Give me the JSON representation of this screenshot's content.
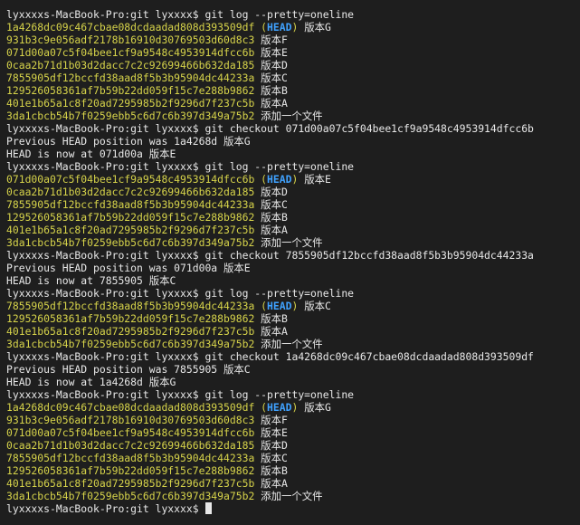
{
  "terminal": {
    "lines": [
      {
        "type": "cmd",
        "text": "lyxxxxs-MacBook-Pro:git lyxxxx$ git log --pretty=oneline"
      },
      {
        "type": "log",
        "hash": "1a4268dc09c467cbae08dcdaadad808d393509df",
        "head": "HEAD",
        "msg": "版本G"
      },
      {
        "type": "log",
        "hash": "931b3c9e056adf2178b16910d30769503d60d8c3",
        "msg": "版本F"
      },
      {
        "type": "log",
        "hash": "071d00a07c5f04bee1cf9a9548c4953914dfcc6b",
        "msg": "版本E"
      },
      {
        "type": "log",
        "hash": "0caa2b71d1b03d2dacc7c2c92699466b632da185",
        "msg": "版本D"
      },
      {
        "type": "log",
        "hash": "7855905df12bccfd38aad8f5b3b95904dc44233a",
        "msg": "版本C"
      },
      {
        "type": "log",
        "hash": "129526058361af7b59b22dd059f15c7e288b9862",
        "msg": "版本B"
      },
      {
        "type": "log",
        "hash": "401e1b65a1c8f20ad7295985b2f9296d7f237c5b",
        "msg": "版本A"
      },
      {
        "type": "log",
        "hash": "3da1cbcb54b7f0259ebb5c6d7c6b397d349a75b2",
        "msg": "添加一个文件"
      },
      {
        "type": "cmd",
        "text": "lyxxxxs-MacBook-Pro:git lyxxxx$ git checkout 071d00a07c5f04bee1cf9a9548c4953914dfcc6b"
      },
      {
        "type": "out",
        "text": "Previous HEAD position was 1a4268d 版本G"
      },
      {
        "type": "out",
        "text": "HEAD is now at 071d00a 版本E"
      },
      {
        "type": "cmd",
        "text": "lyxxxxs-MacBook-Pro:git lyxxxx$ git log --pretty=oneline"
      },
      {
        "type": "log",
        "hash": "071d00a07c5f04bee1cf9a9548c4953914dfcc6b",
        "head": "HEAD",
        "msg": "版本E"
      },
      {
        "type": "log",
        "hash": "0caa2b71d1b03d2dacc7c2c92699466b632da185",
        "msg": "版本D"
      },
      {
        "type": "log",
        "hash": "7855905df12bccfd38aad8f5b3b95904dc44233a",
        "msg": "版本C"
      },
      {
        "type": "log",
        "hash": "129526058361af7b59b22dd059f15c7e288b9862",
        "msg": "版本B"
      },
      {
        "type": "log",
        "hash": "401e1b65a1c8f20ad7295985b2f9296d7f237c5b",
        "msg": "版本A"
      },
      {
        "type": "log",
        "hash": "3da1cbcb54b7f0259ebb5c6d7c6b397d349a75b2",
        "msg": "添加一个文件"
      },
      {
        "type": "cmd",
        "text": "lyxxxxs-MacBook-Pro:git lyxxxx$ git checkout 7855905df12bccfd38aad8f5b3b95904dc44233a"
      },
      {
        "type": "out",
        "text": "Previous HEAD position was 071d00a 版本E"
      },
      {
        "type": "out",
        "text": "HEAD is now at 7855905 版本C"
      },
      {
        "type": "cmd",
        "text": "lyxxxxs-MacBook-Pro:git lyxxxx$ git log --pretty=oneline"
      },
      {
        "type": "log",
        "hash": "7855905df12bccfd38aad8f5b3b95904dc44233a",
        "head": "HEAD",
        "msg": "版本C"
      },
      {
        "type": "log",
        "hash": "129526058361af7b59b22dd059f15c7e288b9862",
        "msg": "版本B"
      },
      {
        "type": "log",
        "hash": "401e1b65a1c8f20ad7295985b2f9296d7f237c5b",
        "msg": "版本A"
      },
      {
        "type": "log",
        "hash": "3da1cbcb54b7f0259ebb5c6d7c6b397d349a75b2",
        "msg": "添加一个文件"
      },
      {
        "type": "cmd",
        "text": "lyxxxxs-MacBook-Pro:git lyxxxx$ git checkout 1a4268dc09c467cbae08dcdaadad808d393509df"
      },
      {
        "type": "out",
        "text": "Previous HEAD position was 7855905 版本C"
      },
      {
        "type": "out",
        "text": "HEAD is now at 1a4268d 版本G"
      },
      {
        "type": "cmd",
        "text": "lyxxxxs-MacBook-Pro:git lyxxxx$ git log --pretty=oneline"
      },
      {
        "type": "log",
        "hash": "1a4268dc09c467cbae08dcdaadad808d393509df",
        "head": "HEAD",
        "msg": "版本G"
      },
      {
        "type": "log",
        "hash": "931b3c9e056adf2178b16910d30769503d60d8c3",
        "msg": "版本F"
      },
      {
        "type": "log",
        "hash": "071d00a07c5f04bee1cf9a9548c4953914dfcc6b",
        "msg": "版本E"
      },
      {
        "type": "log",
        "hash": "0caa2b71d1b03d2dacc7c2c92699466b632da185",
        "msg": "版本D"
      },
      {
        "type": "log",
        "hash": "7855905df12bccfd38aad8f5b3b95904dc44233a",
        "msg": "版本C"
      },
      {
        "type": "log",
        "hash": "129526058361af7b59b22dd059f15c7e288b9862",
        "msg": "版本B"
      },
      {
        "type": "log",
        "hash": "401e1b65a1c8f20ad7295985b2f9296d7f237c5b",
        "msg": "版本A"
      },
      {
        "type": "log",
        "hash": "3da1cbcb54b7f0259ebb5c6d7c6b397d349a75b2",
        "msg": "添加一个文件"
      },
      {
        "type": "prompt",
        "text": "lyxxxxs-MacBook-Pro:git lyxxxx$ "
      }
    ]
  },
  "colors": {
    "background": "#1e1e1e",
    "text": "#e8e8e8",
    "hash": "#d6d34a",
    "head": "#3fa2ff"
  }
}
